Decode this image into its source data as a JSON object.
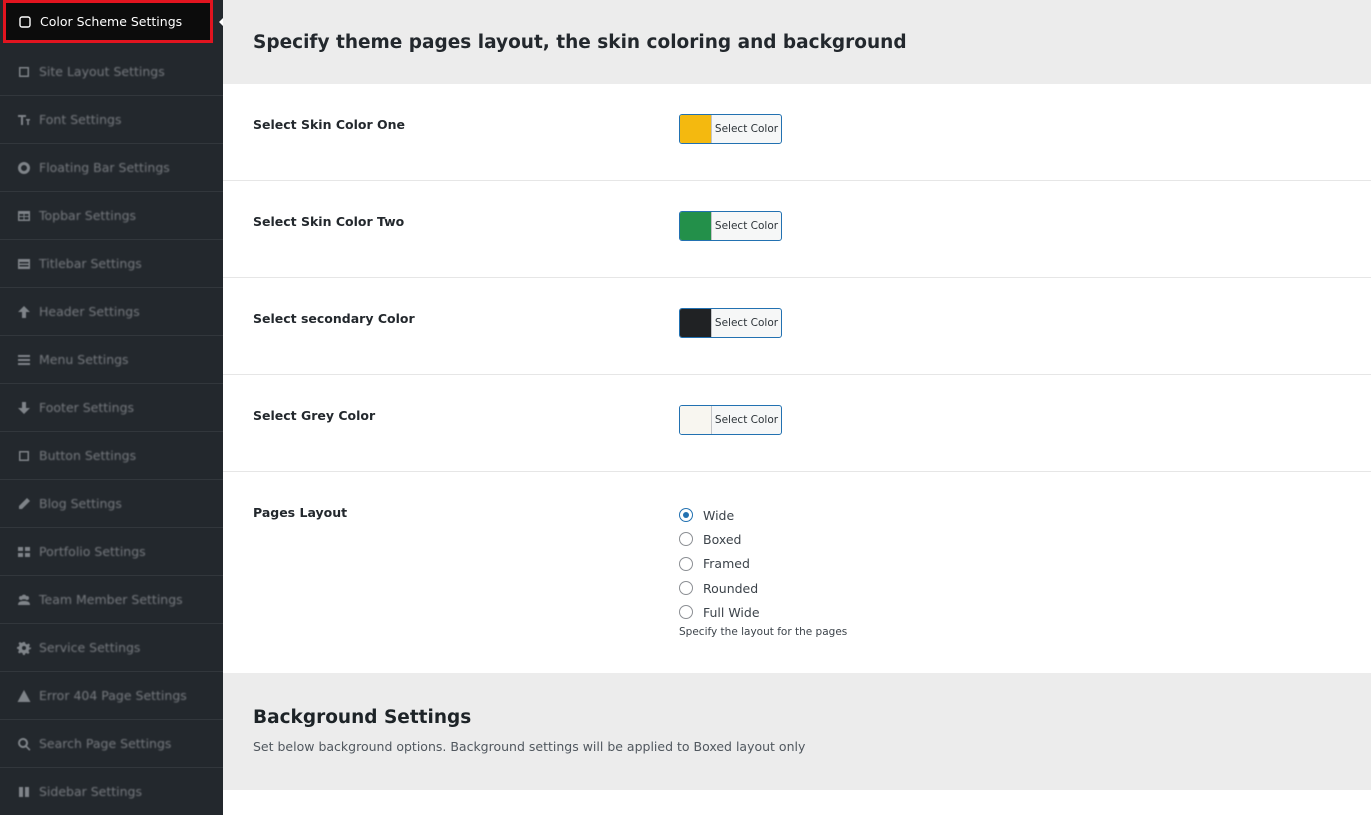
{
  "sidebar": {
    "items": [
      {
        "label": "Color Scheme Settings",
        "icon": "square-icon",
        "active": true
      },
      {
        "label": "Site Layout Settings",
        "icon": "square-icon"
      },
      {
        "label": "Font Settings",
        "icon": "text-icon"
      },
      {
        "label": "Floating Bar Settings",
        "icon": "circle-icon"
      },
      {
        "label": "Topbar Settings",
        "icon": "table-icon"
      },
      {
        "label": "Titlebar Settings",
        "icon": "list-icon"
      },
      {
        "label": "Header Settings",
        "icon": "arrow-up-icon"
      },
      {
        "label": "Menu Settings",
        "icon": "menu-icon"
      },
      {
        "label": "Footer Settings",
        "icon": "arrow-down-icon"
      },
      {
        "label": "Button Settings",
        "icon": "square-icon"
      },
      {
        "label": "Blog Settings",
        "icon": "pencil-icon"
      },
      {
        "label": "Portfolio Settings",
        "icon": "grid-icon"
      },
      {
        "label": "Team Member Settings",
        "icon": "users-icon"
      },
      {
        "label": "Service Settings",
        "icon": "gear-icon"
      },
      {
        "label": "Error 404 Page Settings",
        "icon": "warning-icon"
      },
      {
        "label": "Search Page Settings",
        "icon": "search-icon"
      },
      {
        "label": "Sidebar Settings",
        "icon": "columns-icon"
      }
    ]
  },
  "main": {
    "title": "Specify theme pages layout, the skin coloring and background",
    "color_rows": [
      {
        "label": "Select Skin Color One",
        "button": "Select Color",
        "color": "#f4b90f"
      },
      {
        "label": "Select Skin Color Two",
        "button": "Select Color",
        "color": "#23904a"
      },
      {
        "label": "Select secondary Color",
        "button": "Select Color",
        "color": "#202224"
      },
      {
        "label": "Select Grey Color",
        "button": "Select Color",
        "color": "#f8f6f0"
      }
    ],
    "layout": {
      "label": "Pages Layout",
      "options": [
        "Wide",
        "Boxed",
        "Framed",
        "Rounded",
        "Full Wide"
      ],
      "selected": "Wide",
      "description": "Specify the layout for the pages"
    },
    "background": {
      "title": "Background Settings",
      "description": "Set below background options. Background settings will be applied to Boxed layout only"
    }
  }
}
